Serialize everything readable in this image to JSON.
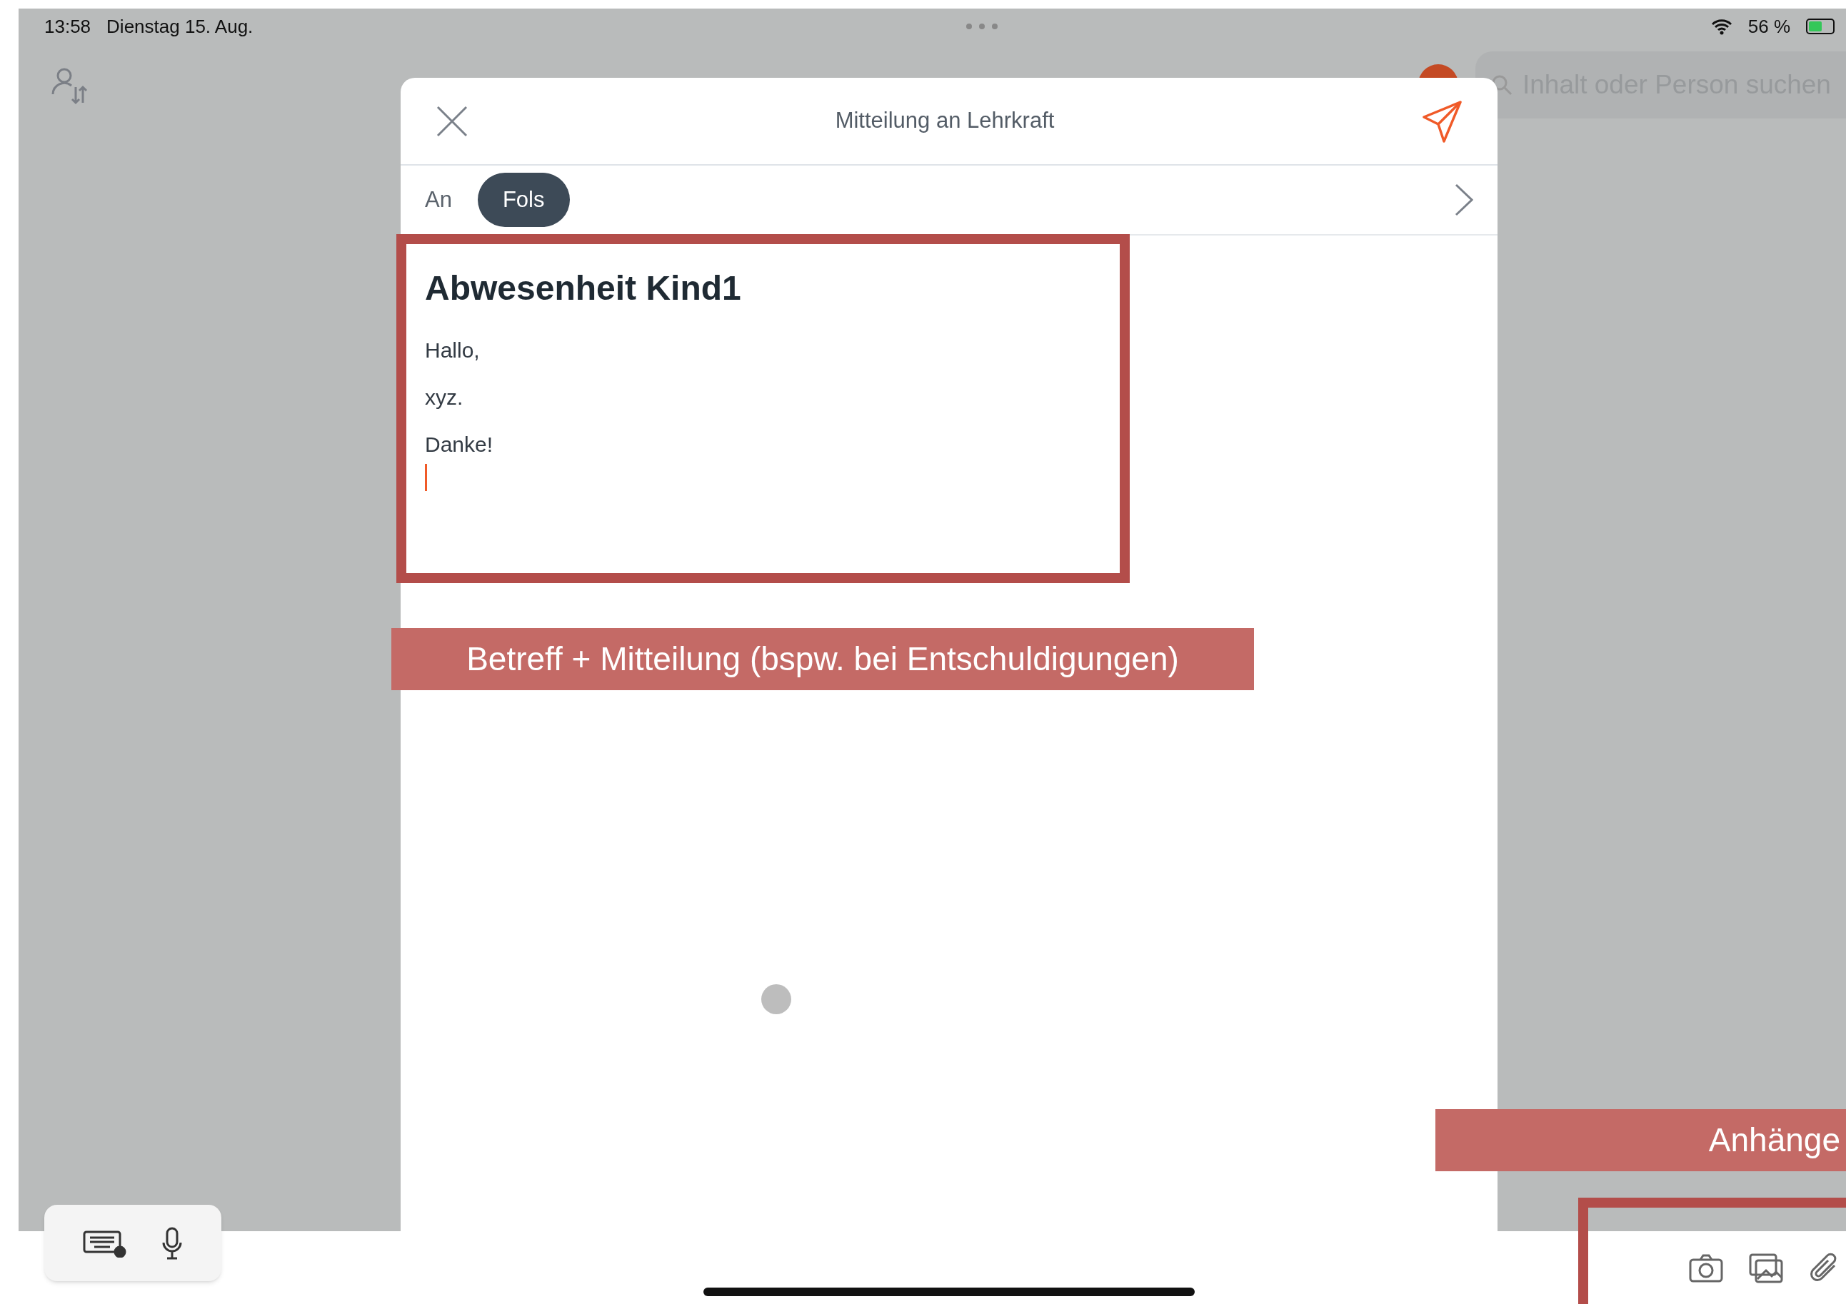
{
  "status_bar": {
    "time": "13:58",
    "date": "Dienstag 15. Aug.",
    "battery": "56 %"
  },
  "search": {
    "placeholder": "Inhalt oder Person suchen"
  },
  "dialog": {
    "title": "Mitteilung an Lehrkraft",
    "recipient_label": "An",
    "recipients": [
      {
        "name": "Fols"
      }
    ],
    "subject": "Abwesenheit Kind1",
    "body": [
      "Hallo,",
      "xyz.",
      "Danke!"
    ]
  },
  "annotations": [
    {
      "text": "Betreff + Mitteilung (bspw. bei Entschuldigungen)"
    },
    {
      "text": "Anhänge"
    }
  ]
}
